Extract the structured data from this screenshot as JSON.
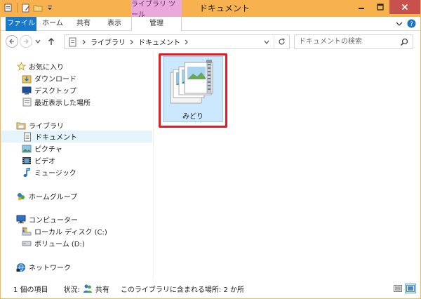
{
  "window": {
    "title": "ドキュメント",
    "context_tab_group": "ライブラリ ツール"
  },
  "ribbon": {
    "tabs": [
      {
        "label": "ファイル",
        "active": true
      },
      {
        "label": "ホーム"
      },
      {
        "label": "共有"
      },
      {
        "label": "表示"
      },
      {
        "label": "管理"
      }
    ],
    "help_label": "?"
  },
  "address": {
    "breadcrumbs": [
      "ライブラリ",
      "ドキュメント"
    ]
  },
  "search": {
    "placeholder": "ドキュメントの検索"
  },
  "nav_pane": {
    "favorites": {
      "label": "お気に入り",
      "items": [
        "ダウンロード",
        "デスクトップ",
        "最近表示した場所"
      ]
    },
    "libraries": {
      "label": "ライブラリ",
      "items": [
        "ドキュメント",
        "ピクチャ",
        "ビデオ",
        "ミュージック"
      ],
      "selected": "ドキュメント"
    },
    "homegroup": {
      "label": "ホームグループ"
    },
    "computer": {
      "label": "コンピューター",
      "items": [
        "ローカル ディスク (C:)",
        "ボリューム (D:)"
      ]
    },
    "network": {
      "label": "ネットワーク"
    }
  },
  "content": {
    "files": [
      {
        "name": "みどり",
        "type": "zip-folder",
        "selected": true
      }
    ]
  },
  "status": {
    "item_count": "1 個の項目",
    "state_label": "状況:",
    "share_status": "共有",
    "locations": "このライブラリに含まれる場所: 2 か所"
  },
  "colors": {
    "titlebar": "#f7b14e",
    "file_tab": "#1979ca",
    "context_tab": "#eaa8dc",
    "selection": "#cce8ff",
    "highlight": "#e61a23"
  }
}
